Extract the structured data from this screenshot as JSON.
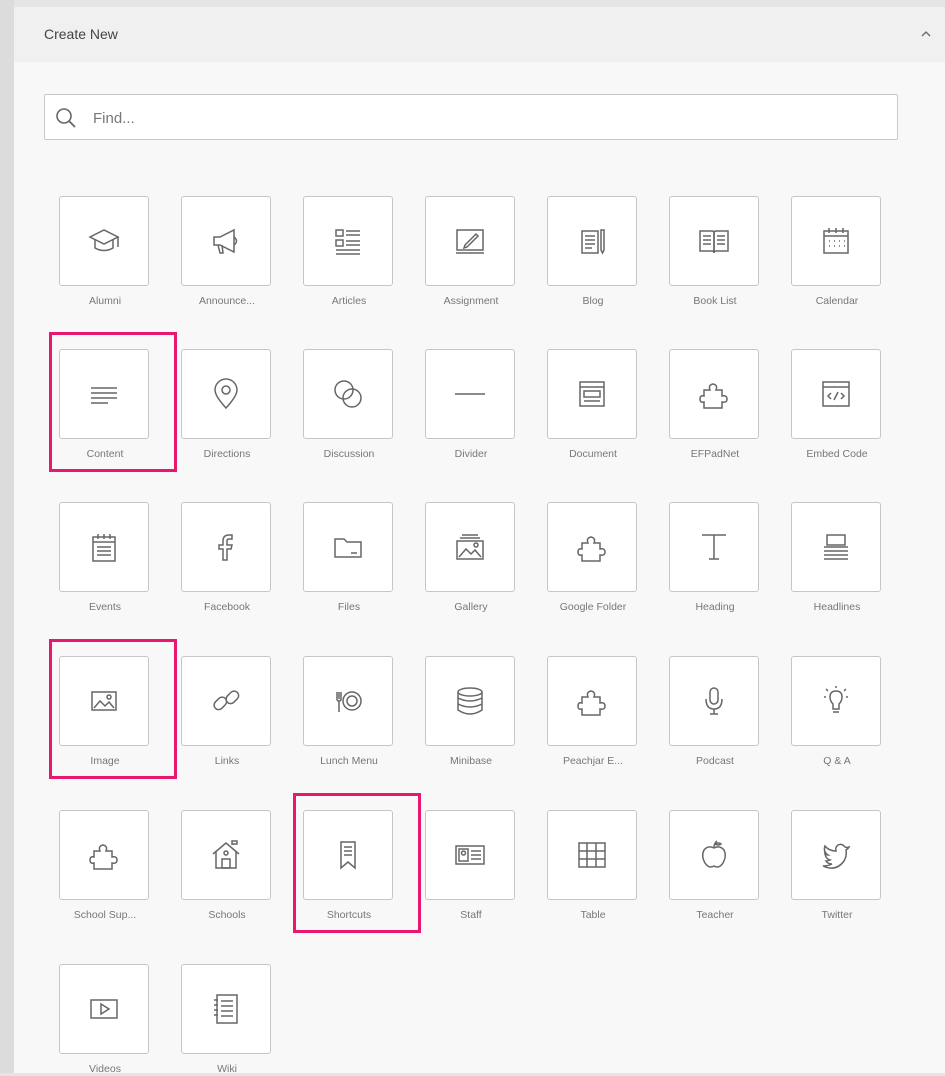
{
  "header": {
    "title": "Create New",
    "collapse_icon": "chevron-up-icon"
  },
  "search": {
    "placeholder": "Find..."
  },
  "accent_color": "#e8186e",
  "tiles": [
    {
      "label": "Alumni",
      "icon": "graduation-cap-icon"
    },
    {
      "label": "Announce...",
      "icon": "megaphone-icon"
    },
    {
      "label": "Articles",
      "icon": "articles-list-icon"
    },
    {
      "label": "Assignment",
      "icon": "pencil-board-icon"
    },
    {
      "label": "Blog",
      "icon": "blog-pen-icon"
    },
    {
      "label": "Book List",
      "icon": "open-book-icon"
    },
    {
      "label": "Calendar",
      "icon": "calendar-icon"
    },
    {
      "label": "Content",
      "icon": "text-lines-icon"
    },
    {
      "label": "Directions",
      "icon": "map-pin-icon"
    },
    {
      "label": "Discussion",
      "icon": "chat-bubbles-icon"
    },
    {
      "label": "Divider",
      "icon": "horizontal-line-icon"
    },
    {
      "label": "Document",
      "icon": "document-window-icon"
    },
    {
      "label": "EFPadNet",
      "icon": "puzzle-piece-icon"
    },
    {
      "label": "Embed Code",
      "icon": "code-window-icon"
    },
    {
      "label": "Events",
      "icon": "events-calendar-icon"
    },
    {
      "label": "Facebook",
      "icon": "facebook-icon"
    },
    {
      "label": "Files",
      "icon": "folder-icon"
    },
    {
      "label": "Gallery",
      "icon": "gallery-icon"
    },
    {
      "label": "Google Folder",
      "icon": "puzzle-piece-icon"
    },
    {
      "label": "Heading",
      "icon": "heading-t-icon"
    },
    {
      "label": "Headlines",
      "icon": "headlines-stack-icon"
    },
    {
      "label": "Image",
      "icon": "image-icon"
    },
    {
      "label": "Links",
      "icon": "chain-link-icon"
    },
    {
      "label": "Lunch Menu",
      "icon": "fork-plate-icon"
    },
    {
      "label": "Minibase",
      "icon": "database-icon"
    },
    {
      "label": "Peachjar E...",
      "icon": "puzzle-piece-icon"
    },
    {
      "label": "Podcast",
      "icon": "microphone-icon"
    },
    {
      "label": "Q & A",
      "icon": "lightbulb-icon"
    },
    {
      "label": "School Sup...",
      "icon": "puzzle-piece-icon"
    },
    {
      "label": "Schools",
      "icon": "school-house-icon"
    },
    {
      "label": "Shortcuts",
      "icon": "bookmark-icon"
    },
    {
      "label": "Staff",
      "icon": "id-card-icon"
    },
    {
      "label": "Table",
      "icon": "table-grid-icon"
    },
    {
      "label": "Teacher",
      "icon": "apple-icon"
    },
    {
      "label": "Twitter",
      "icon": "twitter-bird-icon"
    },
    {
      "label": "Videos",
      "icon": "video-play-icon"
    },
    {
      "label": "Wiki",
      "icon": "wiki-page-icon"
    }
  ],
  "highlighted": [
    "Content",
    "Image",
    "Shortcuts"
  ]
}
